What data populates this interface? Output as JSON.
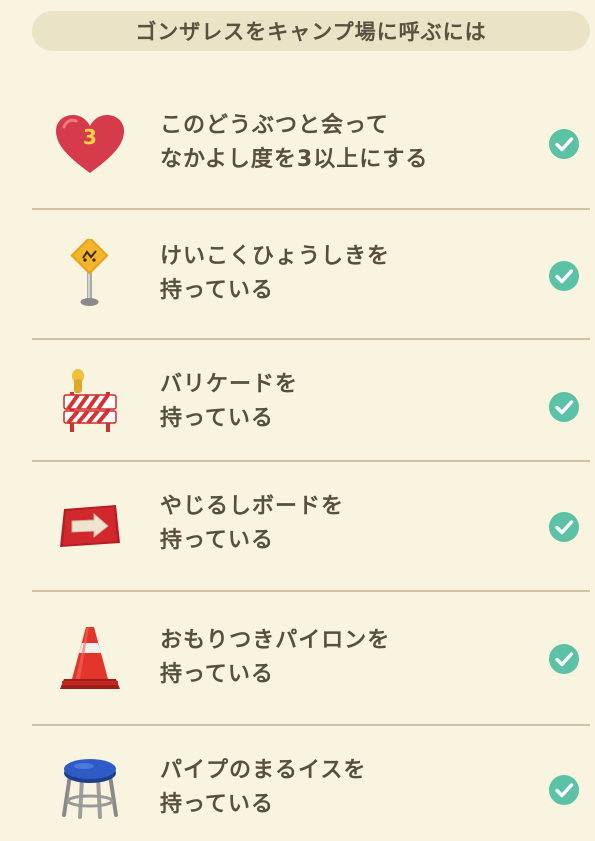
{
  "header": {
    "title": "ゴンザレスをキャンプ場に呼ぶには"
  },
  "conditions": [
    {
      "line1": "このどうぶつと会って",
      "line2": "なかよし度を3以上にする",
      "icon": "heart-icon",
      "heart_number": "3"
    },
    {
      "line1": "けいこくひょうしきを",
      "line2": "持っている",
      "icon": "warning-sign-icon"
    },
    {
      "line1": "バリケードを",
      "line2": "持っている",
      "icon": "barricade-icon"
    },
    {
      "line1": "やじるしボードを",
      "line2": "持っている",
      "icon": "arrow-board-icon"
    },
    {
      "line1": "おもりつきパイロンを",
      "line2": "持っている",
      "icon": "pylon-icon"
    },
    {
      "line1": "パイプのまるイスを",
      "line2": "持っている",
      "icon": "stool-icon"
    }
  ],
  "colors": {
    "background": "#f8f4df",
    "header": "#ebe3c6",
    "check": "#5bc2a6",
    "heart": "#d63b4c",
    "divider": "#cfc3a1"
  }
}
